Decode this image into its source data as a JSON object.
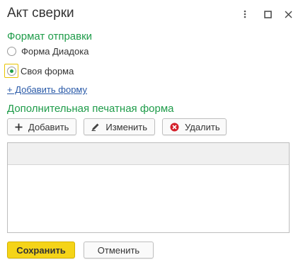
{
  "window": {
    "title": "Акт сверки"
  },
  "send_format": {
    "title": "Формат отправки",
    "options": [
      {
        "label": "Форма Диадока",
        "selected": false
      },
      {
        "label": "Своя форма",
        "selected": true
      }
    ],
    "add_link": "+ Добавить форму"
  },
  "extra_print_form": {
    "title": "Дополнительная печатная форма",
    "buttons": {
      "add": "Добавить",
      "edit": "Изменить",
      "delete": "Удалить"
    },
    "table_rows": []
  },
  "footer": {
    "save": "Сохранить",
    "cancel": "Отменить"
  },
  "colors": {
    "section_title": "#1f9c4a",
    "link": "#2a5aa8",
    "primary_button": "#f5d418",
    "delete_icon": "#d4202a"
  },
  "icons": {
    "more": "more-vertical-icon",
    "maximize": "maximize-icon",
    "close": "close-icon",
    "add": "plus-icon",
    "edit": "pencil-icon",
    "delete": "delete-circle-icon"
  }
}
